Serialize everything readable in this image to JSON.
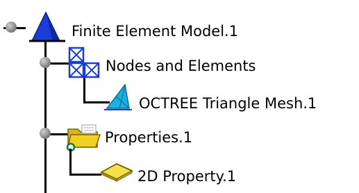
{
  "tree": {
    "root": {
      "label": "Finite Element Model.1",
      "icon": "fem-model-icon"
    },
    "nodes_and_elements": {
      "label": "Nodes and Elements",
      "icon": "nodes-elements-icon",
      "children": [
        {
          "label": "OCTREE Triangle Mesh.1",
          "icon": "triangle-mesh-icon"
        }
      ]
    },
    "properties": {
      "label": "Properties.1",
      "icon": "properties-folder-icon",
      "children": [
        {
          "label": "2D Property.1",
          "icon": "2d-property-icon"
        }
      ]
    }
  },
  "colors": {
    "connector": "#000000",
    "model_blue": "#1a3fd8",
    "mesh_cyan": "#1ab0e0",
    "folder_yellow": "#f0d020",
    "property_yellow": "#f5e04a"
  }
}
